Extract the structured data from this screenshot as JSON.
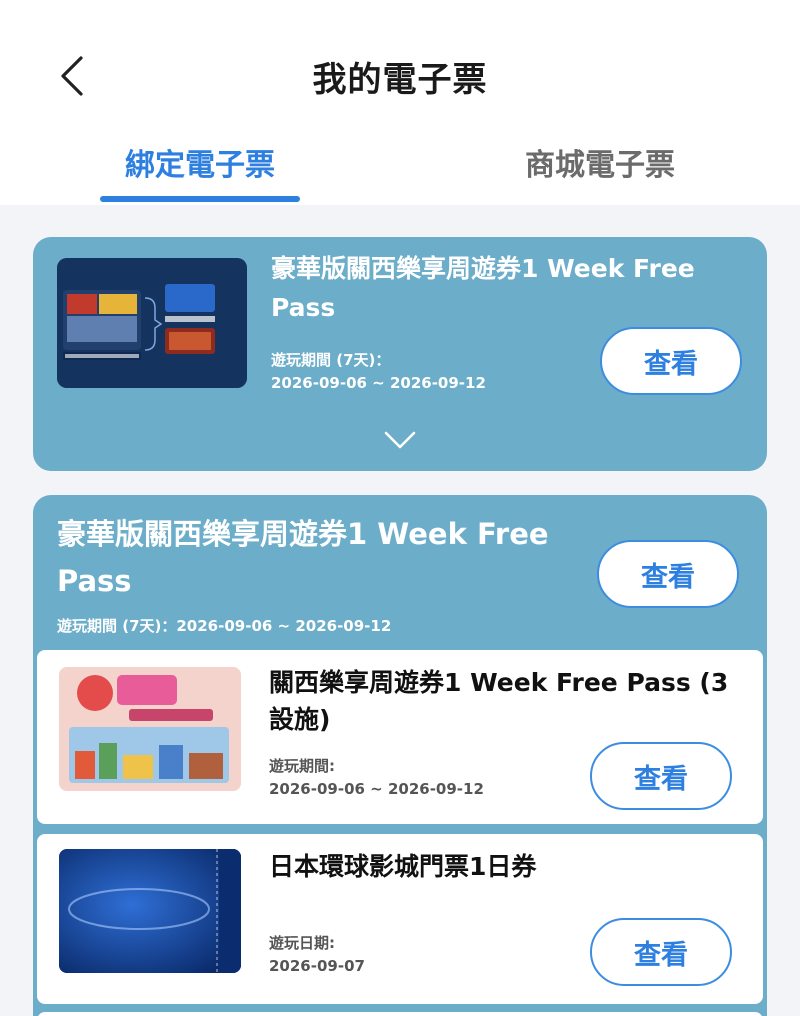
{
  "header": {
    "title": "我的電子票",
    "tabs": [
      {
        "label": "綁定電子票",
        "active": true
      },
      {
        "label": "商城電子票",
        "active": false
      }
    ]
  },
  "tickets": [
    {
      "title": "豪華版關西樂享周遊券1 Week Free Pass",
      "period_label": "遊玩期間 (7天)：",
      "period_value": "2026-09-06 ~ 2026-09-12",
      "button": "查看",
      "collapsed": true,
      "expand_icon": "chevron-down-icon"
    },
    {
      "title": "豪華版關西樂享周遊券1 Week Free Pass",
      "period_inline": "遊玩期間 (7天)：2026-09-06 ~ 2026-09-12",
      "button": "查看",
      "items": [
        {
          "title": "關西樂享周遊券1 Week Free Pass (3設施)",
          "period_label": "遊玩期間:",
          "period_value": "2026-09-06 ~ 2026-09-12",
          "button": "查看"
        },
        {
          "title": "日本環球影城門票1日券",
          "period_label": "遊玩日期:",
          "period_value": "2026-09-07",
          "button": "查看"
        }
      ]
    }
  ],
  "colors": {
    "accent": "#2d7fe0",
    "card_bg": "#6cadc9",
    "page_bg": "#f2f4f7"
  }
}
